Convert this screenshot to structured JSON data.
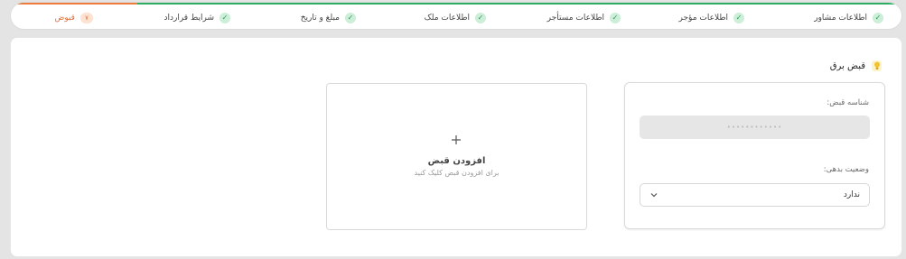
{
  "stepper": {
    "steps": [
      {
        "label": "اطلاعات مشاور",
        "icon": "check-icon"
      },
      {
        "label": "اطلاعات مؤجر",
        "icon": "check-icon"
      },
      {
        "label": "اطلاعات مستأجر",
        "icon": "check-icon"
      },
      {
        "label": "اطلاعات ملک",
        "icon": "check-icon"
      },
      {
        "label": "مبلغ و تاریخ",
        "icon": "check-icon"
      },
      {
        "label": "شرایط قرارداد",
        "icon": "check-icon"
      },
      {
        "label": "قبوض",
        "number": "۷"
      }
    ],
    "colors": {
      "done": "#2eae62",
      "active": "#f07b3f"
    }
  },
  "section": {
    "title": "قبض برق",
    "icon": "lightbulb-icon"
  },
  "bill_card": {
    "bill_id_label": "شناسه قبض:",
    "bill_id_value": "••••••••••••",
    "status_label": "وضعیت بدهی:",
    "status_value": "ندارد"
  },
  "add_card": {
    "icon": "plus-icon",
    "title": "افزودن قبض",
    "subtitle": "برای افزودن قبض کلیک کنید"
  }
}
